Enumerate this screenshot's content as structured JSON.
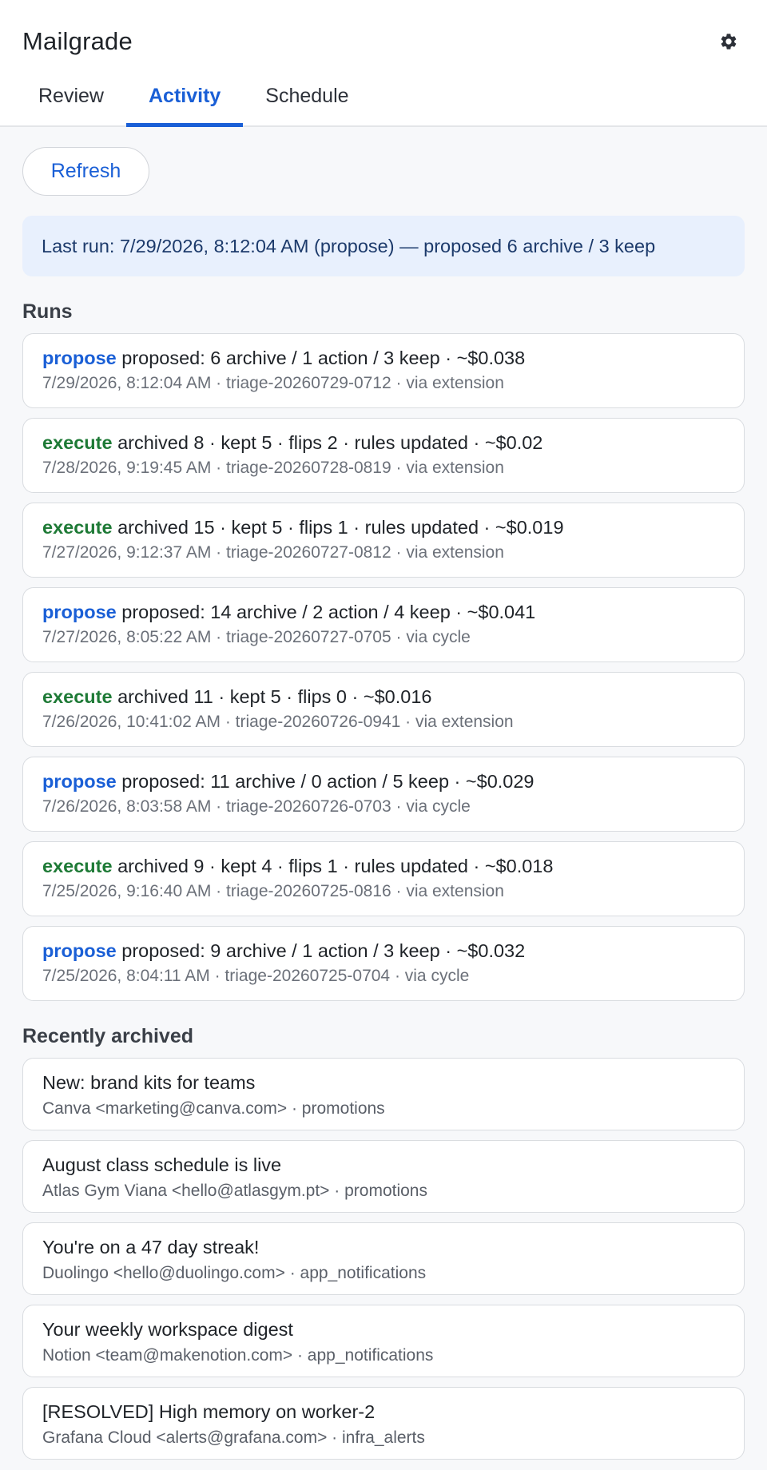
{
  "app": {
    "title": "Mailgrade",
    "settings_icon": "gear-icon"
  },
  "tabs": [
    {
      "label": "Review",
      "active": false
    },
    {
      "label": "Activity",
      "active": true
    },
    {
      "label": "Schedule",
      "active": false
    }
  ],
  "toolbar": {
    "refresh_label": "Refresh"
  },
  "last_run": {
    "text": "Last run: 7/29/2026, 8:12:04 AM (propose) — proposed 6 archive / 3 keep"
  },
  "runs": {
    "title": "Runs",
    "items": [
      {
        "mode": "propose",
        "summary": "proposed: 6 archive / 1 action / 3 keep · ~$0.038",
        "meta": "7/29/2026, 8:12:04 AM · triage-20260729-0712 · via extension"
      },
      {
        "mode": "execute",
        "summary": "archived 8 · kept 5 · flips 2 · rules updated · ~$0.02",
        "meta": "7/28/2026, 9:19:45 AM · triage-20260728-0819 · via extension"
      },
      {
        "mode": "execute",
        "summary": "archived 15 · kept 5 · flips 1 · rules updated · ~$0.019",
        "meta": "7/27/2026, 9:12:37 AM · triage-20260727-0812 · via extension"
      },
      {
        "mode": "propose",
        "summary": "proposed: 14 archive / 2 action / 4 keep · ~$0.041",
        "meta": "7/27/2026, 8:05:22 AM · triage-20260727-0705 · via cycle"
      },
      {
        "mode": "execute",
        "summary": "archived 11 · kept 5 · flips 0 · ~$0.016",
        "meta": "7/26/2026, 10:41:02 AM · triage-20260726-0941 · via extension"
      },
      {
        "mode": "propose",
        "summary": "proposed: 11 archive / 0 action / 5 keep · ~$0.029",
        "meta": "7/26/2026, 8:03:58 AM · triage-20260726-0703 · via cycle"
      },
      {
        "mode": "execute",
        "summary": "archived 9 · kept 4 · flips 1 · rules updated · ~$0.018",
        "meta": "7/25/2026, 9:16:40 AM · triage-20260725-0816 · via extension"
      },
      {
        "mode": "propose",
        "summary": "proposed: 9 archive / 1 action / 3 keep · ~$0.032",
        "meta": "7/25/2026, 8:04:11 AM · triage-20260725-0704 · via cycle"
      }
    ]
  },
  "archived": {
    "title": "Recently archived",
    "items": [
      {
        "subject": "New: brand kits for teams",
        "meta": "Canva <marketing@canva.com> · promotions"
      },
      {
        "subject": "August class schedule is live",
        "meta": "Atlas Gym Viana <hello@atlasgym.pt> · promotions"
      },
      {
        "subject": "You're on a 47 day streak!",
        "meta": "Duolingo <hello@duolingo.com> · app_notifications"
      },
      {
        "subject": "Your weekly workspace digest",
        "meta": "Notion <team@makenotion.com> · app_notifications"
      },
      {
        "subject": "[RESOLVED] High memory on worker-2",
        "meta": "Grafana Cloud <alerts@grafana.com> · infra_alerts"
      }
    ]
  },
  "colors": {
    "accent": "#1a5fd6",
    "execute": "#1e7a36",
    "banner_bg": "#e8f0fd"
  }
}
